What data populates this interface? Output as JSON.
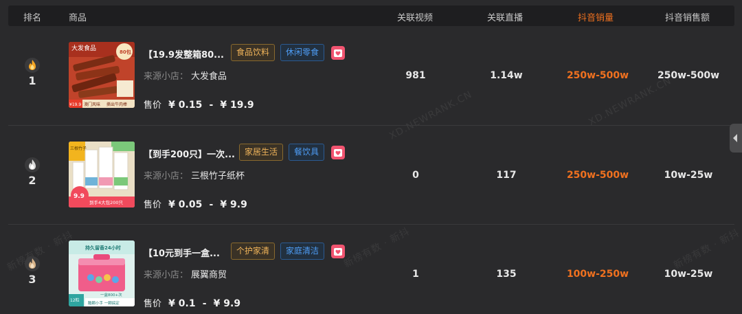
{
  "header": {
    "rank": "排名",
    "product": "商品",
    "related_video": "关联视频",
    "related_live": "关联直播",
    "douyin_sales": "抖音销量",
    "douyin_amount": "抖音销售额"
  },
  "watermarks": [
    "XD.NEWRANK.CN",
    "XD.NEWRANK.CN",
    "新榜有数 · 新抖",
    "新榜有数 · 新抖",
    "新榜有数 · 新抖"
  ],
  "rows": [
    {
      "rank": "1",
      "rank_icon": "flame-gold-icon",
      "title": "【19.9发整箱80...",
      "tags": [
        {
          "label": "食品饮料",
          "style": "amber"
        },
        {
          "label": "休闲零食",
          "style": "blue"
        }
      ],
      "shop_label": "来源小店：",
      "shop_name": "大发食品",
      "price_label": "售价",
      "price_min": "¥ 0.15",
      "price_sep": "-",
      "price_max": "¥ 19.9",
      "related_video": "981",
      "related_live": "1.14w",
      "douyin_sales": "250w-500w",
      "douyin_amount": "250w-500w",
      "thumb_texts": [
        "大发食品",
        "80包",
        "¥19.9",
        "澳门风味",
        "撕出牛肉棒"
      ]
    },
    {
      "rank": "2",
      "rank_icon": "flame-silver-icon",
      "title": "【到手200只】一次...",
      "tags": [
        {
          "label": "家居生活",
          "style": "amber"
        },
        {
          "label": "餐饮具",
          "style": "blue"
        }
      ],
      "shop_label": "来源小店：",
      "shop_name": "三根竹子纸杯",
      "price_label": "售价",
      "price_min": "¥ 0.05",
      "price_sep": "-",
      "price_max": "¥ 9.9",
      "related_video": "0",
      "related_live": "117",
      "douyin_sales": "250w-500w",
      "douyin_amount": "10w-25w",
      "thumb_texts": [
        "三根竹子",
        "9.9",
        "到手4大包200只"
      ]
    },
    {
      "rank": "3",
      "rank_icon": "flame-bronze-icon",
      "title": "【10元到手一盒...",
      "tags": [
        {
          "label": "个护家清",
          "style": "amber"
        },
        {
          "label": "家庭清洁",
          "style": "blue"
        }
      ],
      "shop_label": "来源小店：",
      "shop_name": "展翼商贸",
      "price_label": "售价",
      "price_min": "¥ 0.1",
      "price_sep": "-",
      "price_max": "¥ 9.9",
      "related_video": "1",
      "related_live": "135",
      "douyin_sales": "100w-250w",
      "douyin_amount": "10w-25w",
      "thumb_texts": [
        "持久留香24小时",
        "12粒",
        "一盒800+次",
        "酷颗小手 一颗搞定"
      ]
    }
  ],
  "colors": {
    "accent_orange": "#f0711f",
    "tag_amber": "#f0b45a",
    "tag_blue": "#4e9df5",
    "heart_pink": "#f15470"
  }
}
